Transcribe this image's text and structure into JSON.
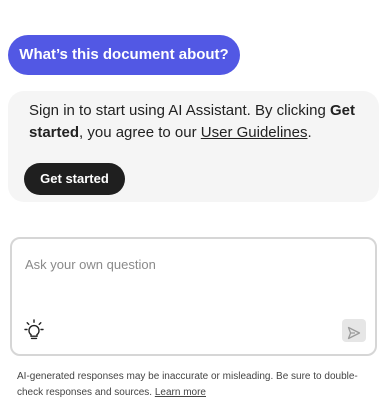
{
  "suggestion": {
    "label": "What’s this document about?"
  },
  "signin_notice": {
    "text_before": "Sign in to start using AI Assistant. By clicking ",
    "bold_text": "Get started",
    "text_middle": ", you agree to our ",
    "link_text": "User Guidelines",
    "text_after": ".",
    "button_label": "Get started"
  },
  "question_box": {
    "placeholder": "Ask your own question",
    "value": "",
    "prompt_icon": "lightbulb-icon",
    "send_icon": "send-icon"
  },
  "disclaimer": {
    "text": "AI-generated responses may be inaccurate or misleading. Be sure to double-check responses and sources. ",
    "link_text": "Learn more"
  },
  "colors": {
    "accent": "#5258e4",
    "dark_button": "#1f1f1f",
    "card_background": "#f5f5f5",
    "input_border": "#d6d6d6"
  }
}
